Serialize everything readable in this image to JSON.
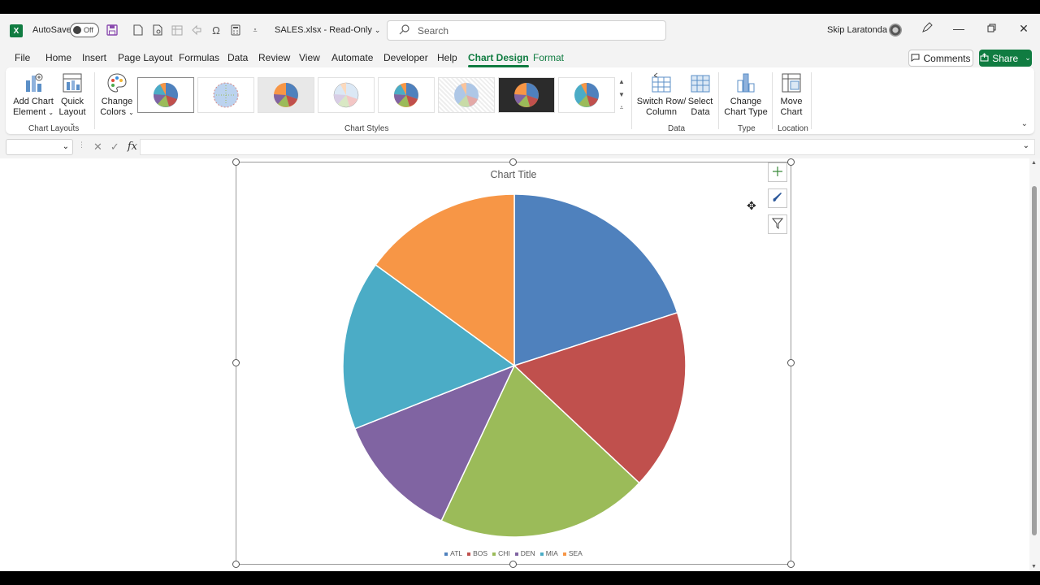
{
  "titlebar": {
    "autosave_label": "AutoSave",
    "autosave_state": "Off",
    "filename": "SALES.xlsx  -  Read-Only",
    "search_placeholder": "Search",
    "user_name": "Skip Laratonda"
  },
  "tabs": [
    "File",
    "Home",
    "Insert",
    "Page Layout",
    "Formulas",
    "Data",
    "Review",
    "View",
    "Automate",
    "Developer",
    "Help",
    "Chart Design",
    "Format"
  ],
  "active_tab": "Chart Design",
  "header_buttons": {
    "comments": "Comments",
    "share": "Share"
  },
  "ribbon": {
    "add_chart_element": [
      "Add Chart",
      "Element"
    ],
    "quick_layout": [
      "Quick",
      "Layout"
    ],
    "change_colors": [
      "Change",
      "Colors"
    ],
    "switch_row_column": [
      "Switch Row/",
      "Column"
    ],
    "select_data": [
      "Select",
      "Data"
    ],
    "change_chart_type": [
      "Change",
      "Chart Type"
    ],
    "move_chart": [
      "Move",
      "Chart"
    ],
    "groups": {
      "chart_layouts": "Chart Layouts",
      "chart_styles": "Chart Styles",
      "data": "Data",
      "type": "Type",
      "location": "Location"
    }
  },
  "formula_bar": {
    "fx": "fx"
  },
  "colors": {
    "accent": "#107c41",
    "ATL": "#4f81bd",
    "BOS": "#c0504d",
    "CHI": "#9bbb59",
    "DEN": "#8064a2",
    "MIA": "#4bacc6",
    "SEA": "#f79646"
  },
  "chart_data": {
    "type": "pie",
    "title": "Chart Title",
    "categories": [
      "ATL",
      "BOS",
      "CHI",
      "DEN",
      "MIA",
      "SEA"
    ],
    "values": [
      20,
      17,
      20,
      12,
      16,
      15
    ],
    "legend_position": "bottom"
  }
}
